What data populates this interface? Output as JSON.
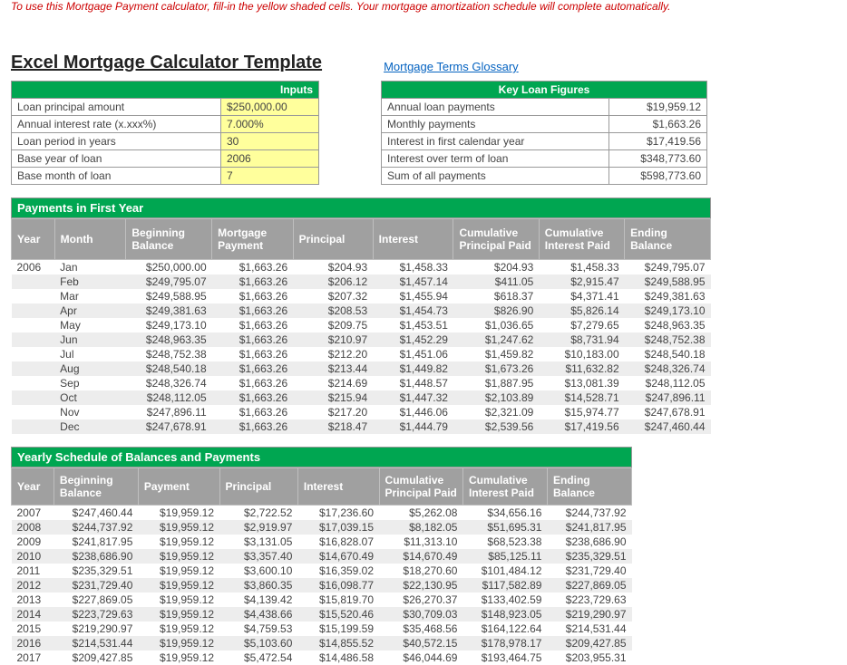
{
  "instruction": "To use this Mortgage Payment calculator, fill-in the yellow shaded cells. Your mortgage amortization schedule will complete automatically.",
  "title": "Excel Mortgage Calculator Template",
  "glossary_link": "Mortgage Terms Glossary",
  "inputs": {
    "header": "Inputs",
    "rows": [
      [
        "Loan principal amount",
        "$250,000.00"
      ],
      [
        "Annual interest rate (x.xxx%)",
        "7.000%"
      ],
      [
        "Loan period in years",
        "30"
      ],
      [
        "Base year of loan",
        "2006"
      ],
      [
        "Base month of loan",
        "7"
      ]
    ]
  },
  "key_figures": {
    "header": "Key Loan Figures",
    "rows": [
      [
        "Annual loan payments",
        "$19,959.12"
      ],
      [
        "Monthly payments",
        "$1,663.26"
      ],
      [
        "Interest in first calendar year",
        "$17,419.56"
      ],
      [
        "Interest over term of loan",
        "$348,773.60"
      ],
      [
        "Sum of all payments",
        "$598,773.60"
      ]
    ]
  },
  "first_year": {
    "header": "Payments in First Year",
    "columns": [
      "Year",
      "Month",
      "Beginning Balance",
      "Mortgage Payment",
      "Principal",
      "Interest",
      "Cumulative Principal Paid",
      "Cumulative Interest Paid",
      "Ending Balance"
    ],
    "year": "2006",
    "rows": [
      [
        "Jan",
        "$250,000.00",
        "$1,663.26",
        "$204.93",
        "$1,458.33",
        "$204.93",
        "$1,458.33",
        "$249,795.07"
      ],
      [
        "Feb",
        "$249,795.07",
        "$1,663.26",
        "$206.12",
        "$1,457.14",
        "$411.05",
        "$2,915.47",
        "$249,588.95"
      ],
      [
        "Mar",
        "$249,588.95",
        "$1,663.26",
        "$207.32",
        "$1,455.94",
        "$618.37",
        "$4,371.41",
        "$249,381.63"
      ],
      [
        "Apr",
        "$249,381.63",
        "$1,663.26",
        "$208.53",
        "$1,454.73",
        "$826.90",
        "$5,826.14",
        "$249,173.10"
      ],
      [
        "May",
        "$249,173.10",
        "$1,663.26",
        "$209.75",
        "$1,453.51",
        "$1,036.65",
        "$7,279.65",
        "$248,963.35"
      ],
      [
        "Jun",
        "$248,963.35",
        "$1,663.26",
        "$210.97",
        "$1,452.29",
        "$1,247.62",
        "$8,731.94",
        "$248,752.38"
      ],
      [
        "Jul",
        "$248,752.38",
        "$1,663.26",
        "$212.20",
        "$1,451.06",
        "$1,459.82",
        "$10,183.00",
        "$248,540.18"
      ],
      [
        "Aug",
        "$248,540.18",
        "$1,663.26",
        "$213.44",
        "$1,449.82",
        "$1,673.26",
        "$11,632.82",
        "$248,326.74"
      ],
      [
        "Sep",
        "$248,326.74",
        "$1,663.26",
        "$214.69",
        "$1,448.57",
        "$1,887.95",
        "$13,081.39",
        "$248,112.05"
      ],
      [
        "Oct",
        "$248,112.05",
        "$1,663.26",
        "$215.94",
        "$1,447.32",
        "$2,103.89",
        "$14,528.71",
        "$247,896.11"
      ],
      [
        "Nov",
        "$247,896.11",
        "$1,663.26",
        "$217.20",
        "$1,446.06",
        "$2,321.09",
        "$15,974.77",
        "$247,678.91"
      ],
      [
        "Dec",
        "$247,678.91",
        "$1,663.26",
        "$218.47",
        "$1,444.79",
        "$2,539.56",
        "$17,419.56",
        "$247,460.44"
      ]
    ]
  },
  "yearly": {
    "header": "Yearly Schedule of Balances and Payments",
    "columns": [
      "Year",
      "Beginning Balance",
      "Payment",
      "Principal",
      "Interest",
      "Cumulative Principal Paid",
      "Cumulative Interest Paid",
      "Ending Balance"
    ],
    "rows": [
      [
        "2007",
        "$247,460.44",
        "$19,959.12",
        "$2,722.52",
        "$17,236.60",
        "$5,262.08",
        "$34,656.16",
        "$244,737.92"
      ],
      [
        "2008",
        "$244,737.92",
        "$19,959.12",
        "$2,919.97",
        "$17,039.15",
        "$8,182.05",
        "$51,695.31",
        "$241,817.95"
      ],
      [
        "2009",
        "$241,817.95",
        "$19,959.12",
        "$3,131.05",
        "$16,828.07",
        "$11,313.10",
        "$68,523.38",
        "$238,686.90"
      ],
      [
        "2010",
        "$238,686.90",
        "$19,959.12",
        "$3,357.40",
        "$14,670.49",
        "$14,670.49",
        "$85,125.11",
        "$235,329.51"
      ],
      [
        "2011",
        "$235,329.51",
        "$19,959.12",
        "$3,600.10",
        "$16,359.02",
        "$18,270.60",
        "$101,484.12",
        "$231,729.40"
      ],
      [
        "2012",
        "$231,729.40",
        "$19,959.12",
        "$3,860.35",
        "$16,098.77",
        "$22,130.95",
        "$117,582.89",
        "$227,869.05"
      ],
      [
        "2013",
        "$227,869.05",
        "$19,959.12",
        "$4,139.42",
        "$15,819.70",
        "$26,270.37",
        "$133,402.59",
        "$223,729.63"
      ],
      [
        "2014",
        "$223,729.63",
        "$19,959.12",
        "$4,438.66",
        "$15,520.46",
        "$30,709.03",
        "$148,923.05",
        "$219,290.97"
      ],
      [
        "2015",
        "$219,290.97",
        "$19,959.12",
        "$4,759.53",
        "$15,199.59",
        "$35,468.56",
        "$164,122.64",
        "$214,531.44"
      ],
      [
        "2016",
        "$214,531.44",
        "$19,959.12",
        "$5,103.60",
        "$14,855.52",
        "$40,572.15",
        "$178,978.17",
        "$209,427.85"
      ],
      [
        "2017",
        "$209,427.85",
        "$19,959.12",
        "$5,472.54",
        "$14,486.58",
        "$46,044.69",
        "$193,464.75",
        "$203,955.31"
      ]
    ]
  }
}
